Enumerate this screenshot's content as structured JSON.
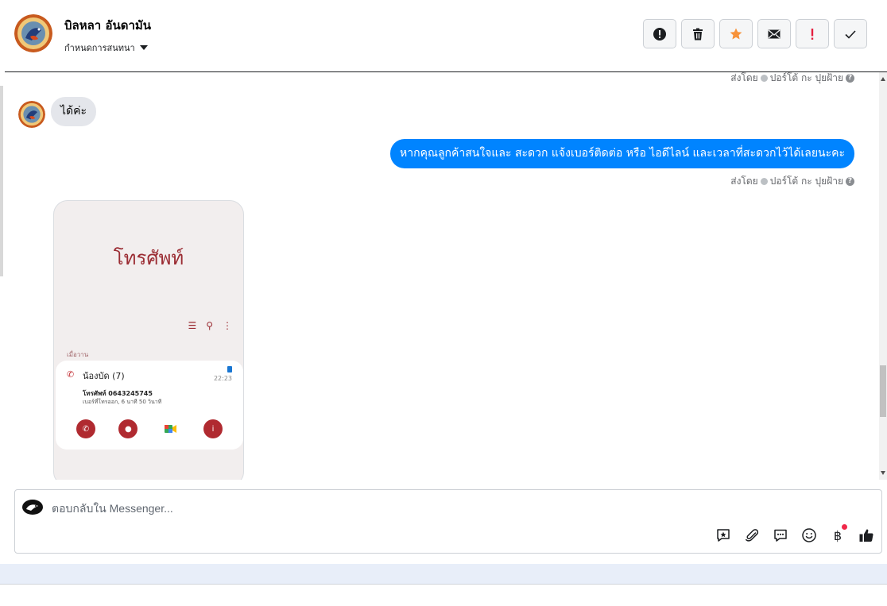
{
  "header": {
    "contact_name": "บิลหลา อันดามัน",
    "label_dropdown": "กำหนดการสนทนา",
    "actions": [
      {
        "name": "report-spam",
        "icon": "alert-circle-icon"
      },
      {
        "name": "delete",
        "icon": "trash-icon"
      },
      {
        "name": "star",
        "icon": "star-icon",
        "color": "#f7923a"
      },
      {
        "name": "mark-unread",
        "icon": "envelope-icon"
      },
      {
        "name": "follow-up",
        "icon": "exclamation-icon",
        "color": "#e41e3f"
      },
      {
        "name": "mark-done",
        "icon": "check-icon"
      }
    ]
  },
  "messages": {
    "top_meta": {
      "prefix": "ส่งโดย",
      "sender": "ปอร์โต้ กะ ปุยฝ้าย"
    },
    "incoming_text": "ได้ค่ะ",
    "outgoing_text": "หากคุณลูกค้าสนใจและ สะดวก แจ้งเบอร์ติดต่อ หรือ ไอดีไลน์ และเวลาที่สะดวกไว้ได้เลยนะคะ",
    "outgoing_meta": {
      "prefix": "ส่งโดย",
      "sender": "ปอร์โต้ กะ ปุยฝ้าย"
    }
  },
  "attachment": {
    "title": "โทรศัพท์",
    "section": "เมื่อวาน",
    "contact": "น้องบัด (7)",
    "time": "22:23",
    "number_line": "โทรศัพท์ 0643245745",
    "detail_line": "เบอร์ที่โทรออก, 6 นาที 50 วินาที"
  },
  "composer": {
    "placeholder": "ตอบกลับใน Messenger...",
    "baht_symbol": "฿"
  },
  "colors": {
    "accent": "#0084ff",
    "incoming_bubble": "#e4e6eb",
    "phone_accent": "#9b2c33"
  }
}
